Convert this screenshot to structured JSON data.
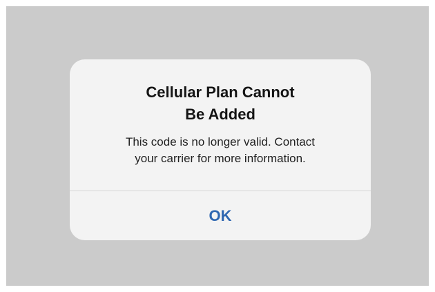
{
  "alert": {
    "title_line1": "Cellular Plan Cannot",
    "title_line2": "Be Added",
    "message_line1": "This code is no longer valid. Contact",
    "message_line2": "your carrier for more information.",
    "ok_label": "OK"
  },
  "colors": {
    "backdrop": "#cbcbcb",
    "alert_background": "#f3f3f3",
    "button_text": "#2f67b1",
    "title_text": "#141414"
  }
}
